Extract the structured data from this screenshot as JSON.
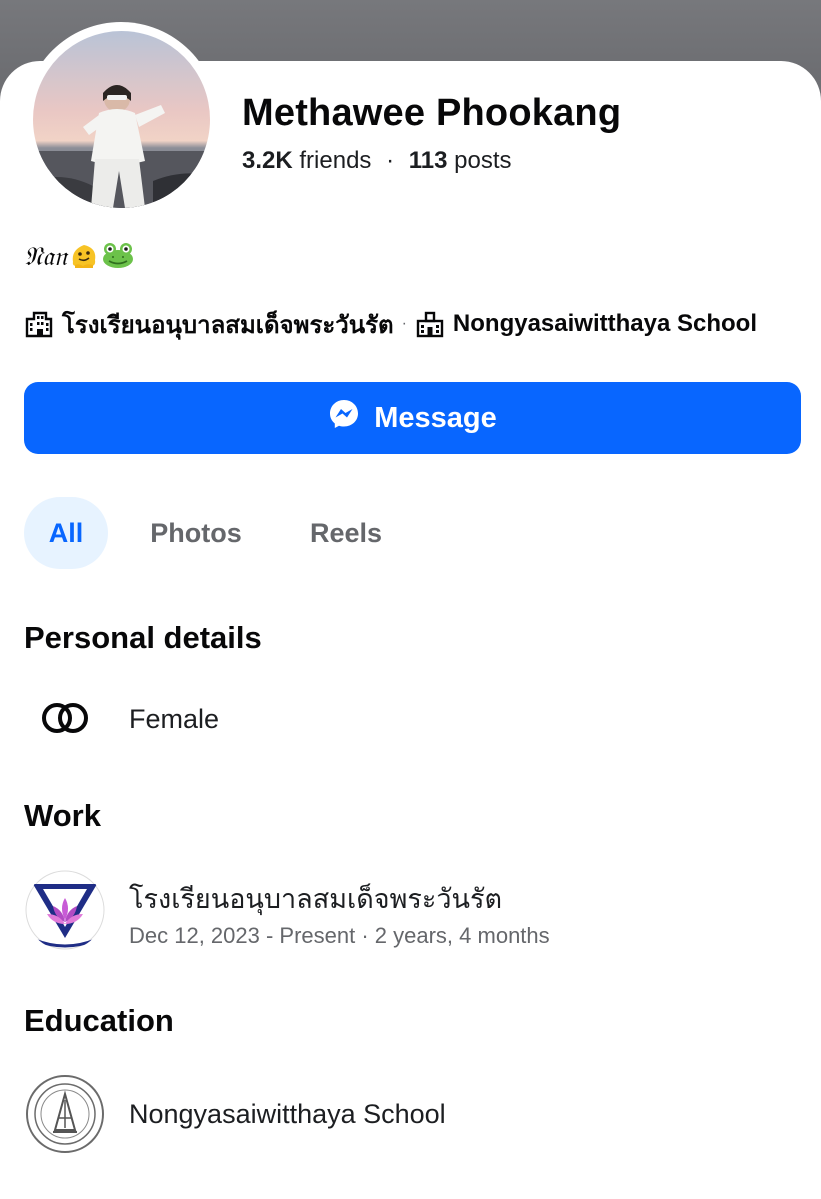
{
  "profile": {
    "name": "Methawee Phookang",
    "friends_count": "3.2K",
    "friends_label": "friends",
    "separator": "·",
    "posts_count": "113",
    "posts_label": "posts",
    "bio_text": "𝔑𝔞𝔫",
    "bio_emojis": [
      "🫠",
      "🐸"
    ]
  },
  "work_line": {
    "employer": "โรงเรียนอนุบาลสมเด็จพระวันรัต",
    "separator": "·",
    "school": "Nongyasaiwitthaya School"
  },
  "actions": {
    "message_label": "Message"
  },
  "tabs": [
    {
      "label": "All",
      "active": true
    },
    {
      "label": "Photos",
      "active": false
    },
    {
      "label": "Reels",
      "active": false
    }
  ],
  "sections": {
    "personal": {
      "title": "Personal details",
      "gender": "Female"
    },
    "work": {
      "title": "Work",
      "employer": "โรงเรียนอนุบาลสมเด็จพระวันรัต",
      "period": "Dec 12, 2023 - Present · 2 years, 4 months"
    },
    "education": {
      "title": "Education",
      "school": "Nongyasaiwitthaya School"
    }
  },
  "colors": {
    "accent": "#0866ff",
    "active_tab_bg": "#e7f3ff",
    "secondary_text": "#65676b",
    "cover_gray": "#6f7074"
  },
  "icons": {
    "message": "messenger-icon",
    "work": "building-icon",
    "education": "school-building-icon",
    "gender": "interlocking-rings-icon"
  }
}
